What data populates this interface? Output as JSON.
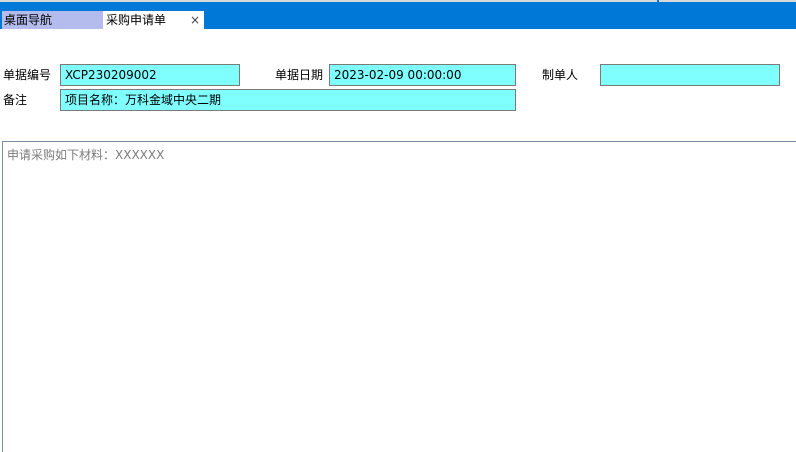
{
  "tabs": {
    "home_label": "桌面导航",
    "active_label": "采购申请单",
    "close_glyph": "×"
  },
  "form": {
    "doc_no_label": "单据编号",
    "doc_no_value": "XCP230209002",
    "doc_date_label": "单据日期",
    "doc_date_value": "2023-02-09 00:00:00",
    "creator_label": "制单人",
    "creator_value": "",
    "remark_label": "备注",
    "remark_value": "项目名称：万科金域中央二期"
  },
  "memo": {
    "text": "申请采购如下材料：XXXXXX"
  },
  "colors": {
    "tabbar": "#0078d7",
    "home_tab": "#b3bcec",
    "field_bg": "#80ffff"
  }
}
